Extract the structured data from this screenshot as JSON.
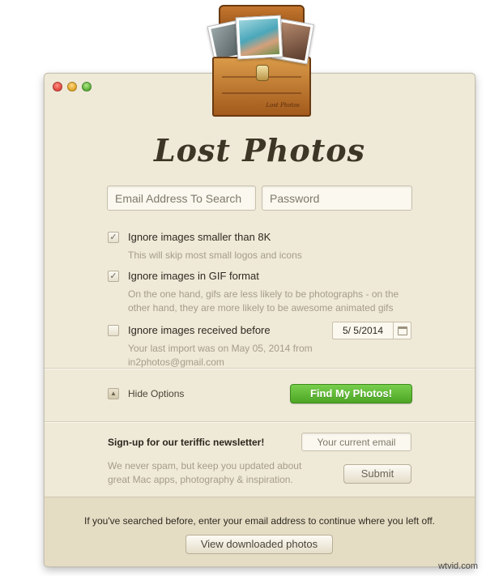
{
  "window": {
    "traffic_lights": [
      {
        "name": "close-button",
        "color": "#e0443a"
      },
      {
        "name": "minimize-button",
        "color": "#e0a422"
      },
      {
        "name": "zoom-button",
        "color": "#57ad35"
      }
    ],
    "app_title": "Lost Photos",
    "chest_label": "Lost Photos"
  },
  "login": {
    "email_placeholder": "Email Address To Search",
    "password_placeholder": "Password"
  },
  "options": [
    {
      "label": "Ignore images smaller than 8K",
      "description": "This will skip most small logos and icons",
      "checked": true
    },
    {
      "label": "Ignore images in GIF format",
      "description": "On the one hand, gifs are less likely to be photographs - on the other hand, they are more likely to be awesome animated gifs",
      "checked": true
    },
    {
      "label": "Ignore images received before",
      "description": "Your last import was on May 05, 2014 from in2photos@gmail.com",
      "checked": false,
      "date": "5/  5/2014"
    }
  ],
  "actions": {
    "hide_options_label": "Hide Options",
    "find_button_label": "Find My Photos!",
    "find_button_color": "#5db933"
  },
  "newsletter": {
    "title": "Sign-up for our teriffic newsletter!",
    "email_placeholder": "Your current email",
    "description": "We never spam, but keep you updated about great Mac apps, photography & inspiration.",
    "submit_label": "Submit"
  },
  "footer": {
    "text": "If you've searched before, enter your email address to continue where you left off.",
    "view_button_label": "View downloaded photos"
  },
  "watermark": "wtvid.com"
}
